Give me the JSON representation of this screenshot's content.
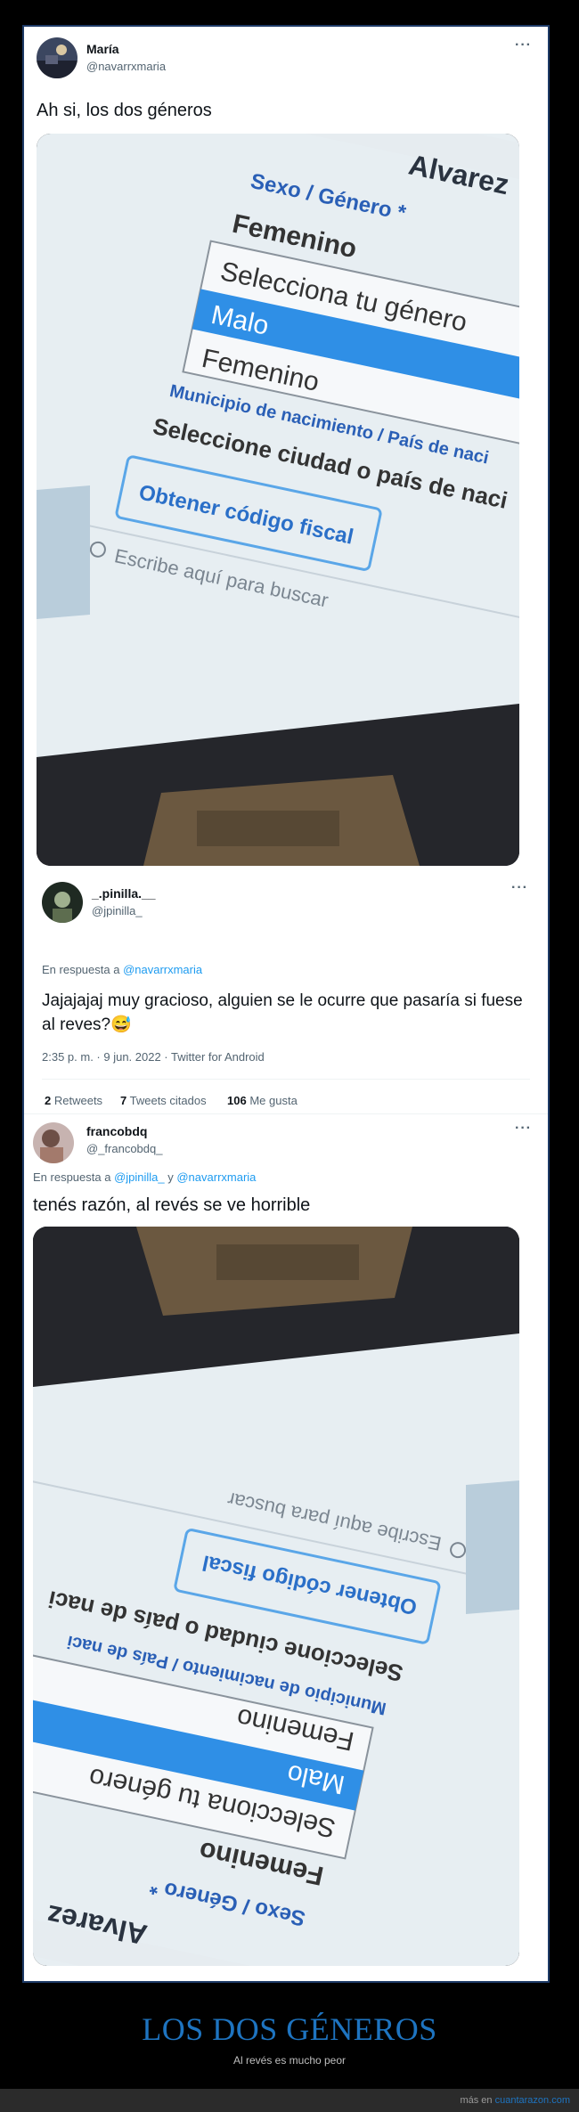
{
  "tweet1": {
    "name": "María",
    "handle": "@navarrxmaria",
    "text": "Ah si, los dos géneros"
  },
  "tweet2": {
    "name": "_.pinilla.__",
    "handle": "@jpinilla_",
    "reply_prefix": "En respuesta a ",
    "reply_to": "@navarrxmaria",
    "text": "Jajajajaj muy gracioso, alguien se le ocurre que pasaría si fuese al reves?",
    "emoji": "😅",
    "meta": "2:35 p. m. · 9 jun. 2022 · Twitter for Android",
    "retweets_count": "2",
    "retweets_label": "Retweets",
    "quotes_count": "7",
    "quotes_label": "Tweets citados",
    "likes_count": "106",
    "likes_label": "Me gusta"
  },
  "tweet3": {
    "name": "francobdq",
    "handle": "@_francobdq_",
    "reply_prefix": "En respuesta a ",
    "reply_to_1": "@jpinilla_",
    "reply_and": " y ",
    "reply_to_2": "@navarrxmaria",
    "text": "tenés razón, al revés se ve horrible"
  },
  "more_icon": "···",
  "screen": {
    "top_name": "Alvarez",
    "field_label": "Sexo / Género *",
    "selected_value": "Femenino",
    "option_placeholder": "Selecciona tu género",
    "option_male": "Malo",
    "option_female": "Femenino",
    "field_birthplace": "Municipio de nacimiento / País de naci",
    "select_city": "Seleccione ciudad o país de naci",
    "button_fiscal": "Obtener código fiscal",
    "search_placeholder": "Escribe aquí para buscar"
  },
  "footer": {
    "title": "LOS DOS GÉNEROS",
    "subtitle": "Al revés es mucho peor",
    "credit_prefix": "más en ",
    "credit_site": "cuantarazon.com"
  },
  "colors": {
    "link": "#1d9bf0",
    "highlight": "#2f8fe6",
    "footer_title": "#1e74c0"
  }
}
